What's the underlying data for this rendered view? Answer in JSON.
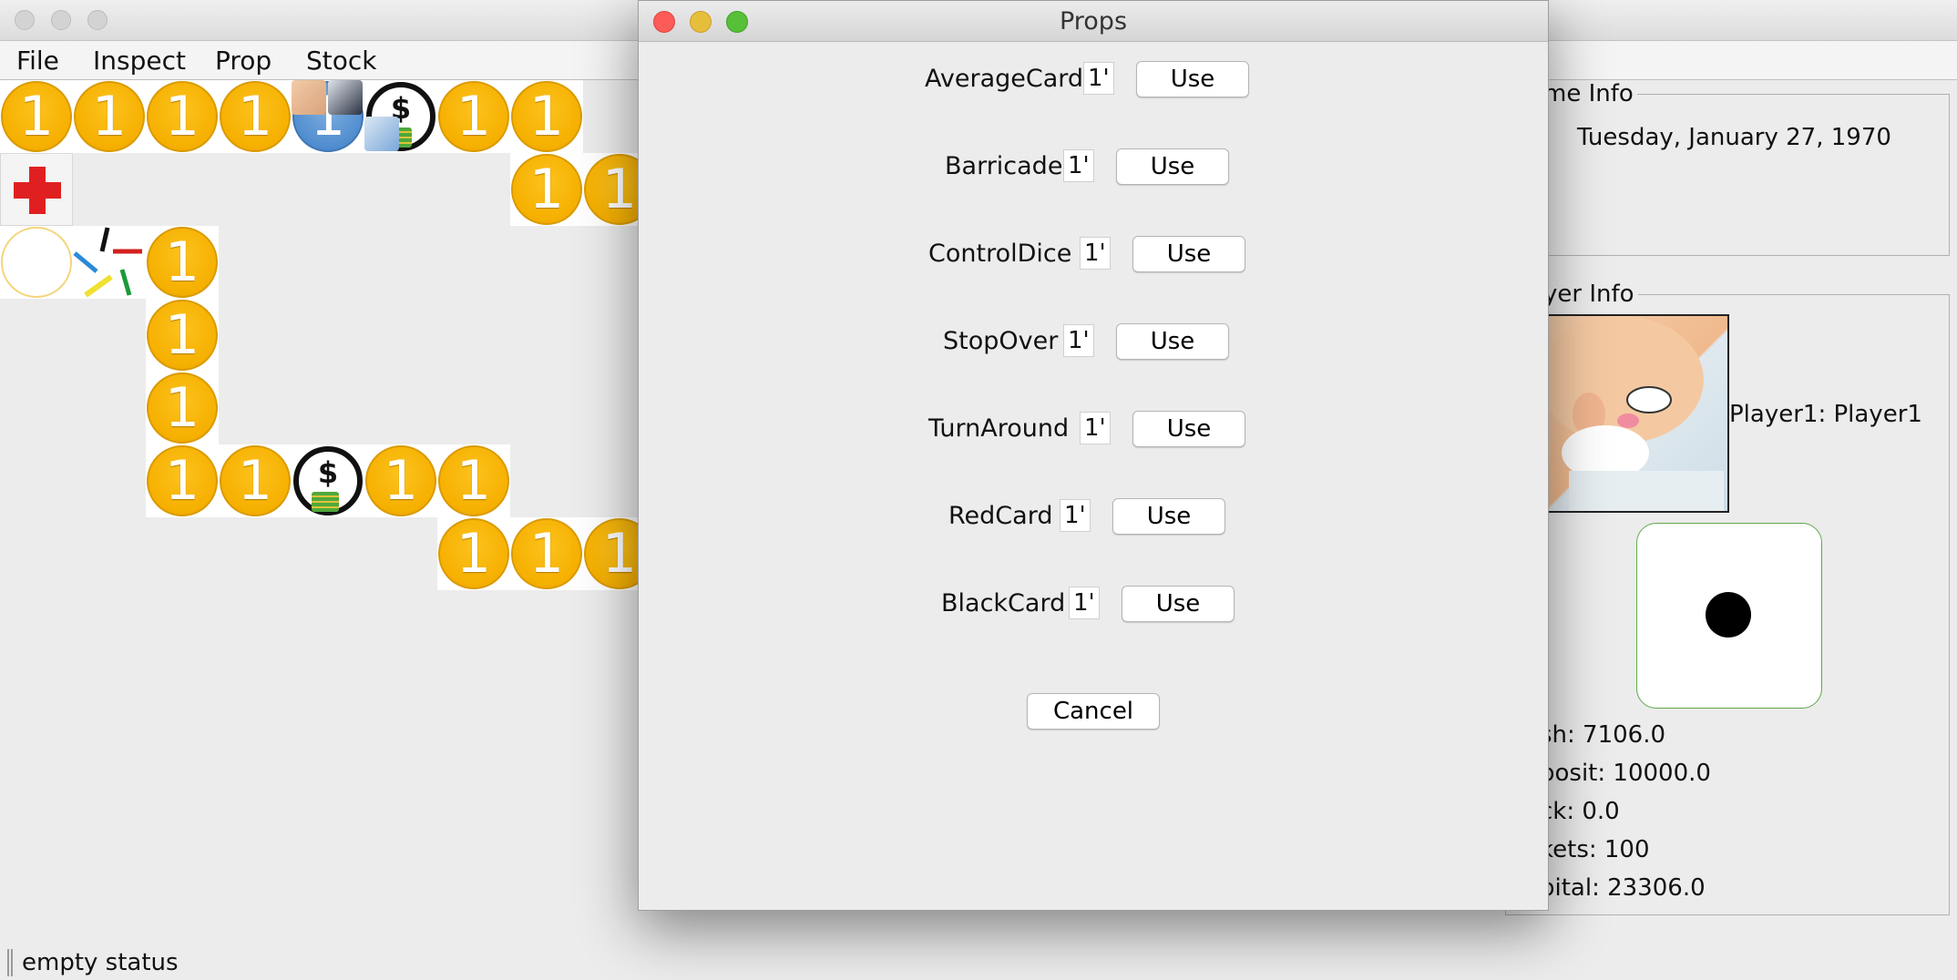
{
  "menu": {
    "items": [
      "File",
      "Inspect",
      "Prop",
      "Stock"
    ]
  },
  "board": {
    "coin_label": "1"
  },
  "right_panel": {
    "game_info_legend": "me Info",
    "date": "Tuesday, January 27, 1970",
    "player_info_legend": "yer Info",
    "player_name": "Player1: Player1",
    "cash": "sh: 7106.0",
    "deposit": "posit: 10000.0",
    "stock": "ck: 0.0",
    "tickets": "kets: 100",
    "capital": "pital: 23306.0"
  },
  "status": {
    "text": "empty status"
  },
  "dialog": {
    "title": "Props",
    "props": [
      {
        "name": "AverageCard",
        "count": "1'",
        "button": "Use"
      },
      {
        "name": "Barricade",
        "count": "1'",
        "button": "Use"
      },
      {
        "name": "ControlDice",
        "count": "1'",
        "button": "Use"
      },
      {
        "name": "StopOver",
        "count": "1'",
        "button": "Use"
      },
      {
        "name": "TurnAround",
        "count": "1'",
        "button": "Use"
      },
      {
        "name": "RedCard",
        "count": "1'",
        "button": "Use"
      },
      {
        "name": "BlackCard",
        "count": "1'",
        "button": "Use"
      }
    ],
    "cancel_label": "Cancel"
  },
  "colors": {
    "coin": "#f6b000",
    "close": "#fc5b57",
    "minimize": "#e5bf3c",
    "maximize": "#57c038",
    "dice_border": "#5fa84b"
  }
}
